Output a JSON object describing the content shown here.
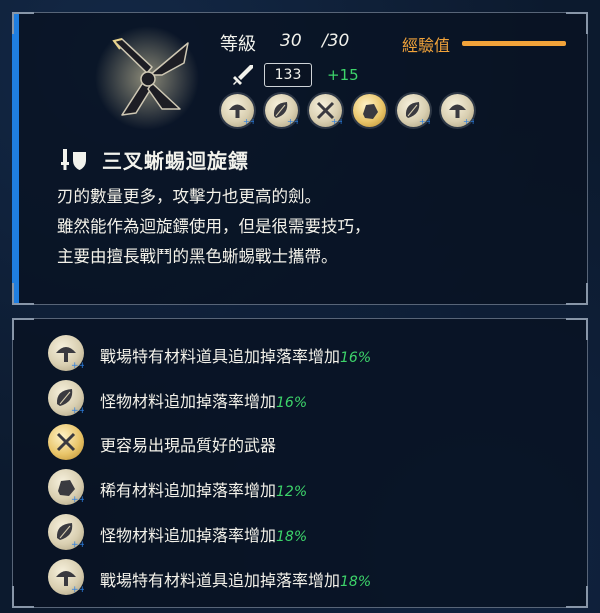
{
  "level": {
    "label": "等級",
    "current": "30",
    "max": "/30"
  },
  "experience": {
    "label": "經驗值",
    "progress": 1.0
  },
  "attack": {
    "value": "133",
    "bonus": "+15"
  },
  "weapon": {
    "name": "三叉蜥蜴迴旋鏢",
    "description": [
      "刃的數量更多，攻擊力也更高的劍。",
      "雖然能作為迴旋鏢使用，但是很需要技巧，",
      "主要由擅長戰鬥的黑色蜥蜴戰士攜帶。"
    ]
  },
  "modifiers": [
    {
      "icon": "mushroom-icon",
      "style": "silver"
    },
    {
      "icon": "leaf-icon",
      "style": "silver"
    },
    {
      "icon": "crossed-swords-icon",
      "style": "silver"
    },
    {
      "icon": "ore-icon",
      "style": "gold"
    },
    {
      "icon": "leaf-icon",
      "style": "silver"
    },
    {
      "icon": "mushroom-icon",
      "style": "silver"
    }
  ],
  "bonuses": [
    {
      "icon": "mushroom-icon",
      "style": "silver",
      "text": "戰場特有材料道具追加掉落率增加",
      "pct": "16%"
    },
    {
      "icon": "leaf-icon",
      "style": "silver",
      "text": "怪物材料追加掉落率增加",
      "pct": "16%"
    },
    {
      "icon": "crossed-swords-icon",
      "style": "gold",
      "text": "更容易出現品質好的武器",
      "pct": ""
    },
    {
      "icon": "ore-icon",
      "style": "silver",
      "text": "稀有材料追加掉落率增加",
      "pct": "12%"
    },
    {
      "icon": "leaf-icon",
      "style": "silver",
      "text": "怪物材料追加掉落率增加",
      "pct": "18%"
    },
    {
      "icon": "mushroom-icon",
      "style": "silver",
      "text": "戰場特有材料道具追加掉落率增加",
      "pct": "18%"
    }
  ],
  "colors": {
    "accent": "#1f7ee0",
    "exp": "#f2a33a",
    "bonus": "#3dd46a"
  }
}
